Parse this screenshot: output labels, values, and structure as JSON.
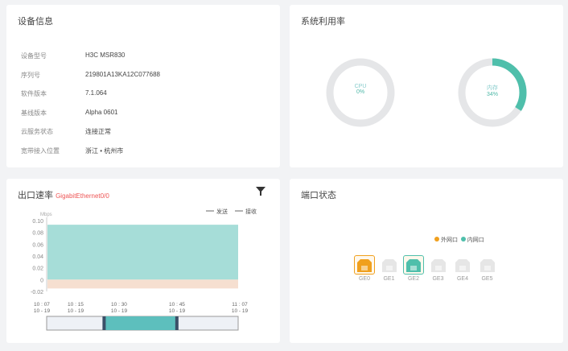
{
  "device_info": {
    "title": "设备信息",
    "rows": [
      {
        "label": "设备型号",
        "value": "H3C MSR830"
      },
      {
        "label": "序列号",
        "value": "219801A13KA12C077688"
      },
      {
        "label": "软件版本",
        "value": "7.1.064"
      },
      {
        "label": "基线版本",
        "value": "Alpha 0601"
      },
      {
        "label": "云服务状态",
        "value": "连接正常"
      },
      {
        "label": "宽带接入位置",
        "value": "浙江 • 杭州市"
      }
    ]
  },
  "system_usage": {
    "title": "系统利用率",
    "cpu": {
      "label": "CPU",
      "value": "0%",
      "percent": 0
    },
    "memory": {
      "label": "内存",
      "value": "34%",
      "percent": 34
    },
    "accent": "#4fbfab"
  },
  "egress": {
    "title": "出口速率",
    "interface": "GigabitEthernet0/0",
    "filter_icon": "filter-icon",
    "chart_data": {
      "type": "area",
      "ylabel": "Mbps",
      "yticks": [
        "0.10",
        "0.08",
        "0.06",
        "0.04",
        "0.02",
        "0",
        "-0.02"
      ],
      "ylim": [
        -0.02,
        0.1
      ],
      "xticks": [
        {
          "t": "10 : 07",
          "d": "10 - 19"
        },
        {
          "t": "10 : 15",
          "d": "10 - 19"
        },
        {
          "t": "10 : 30",
          "d": "10 - 19"
        },
        {
          "t": "10 : 45",
          "d": "10 - 19"
        },
        {
          "t": "11 : 07",
          "d": "10 - 19"
        }
      ],
      "series": [
        {
          "name": "发送",
          "value": 0.093,
          "color": "#a6ddd8"
        },
        {
          "name": "接收",
          "value": -0.015,
          "color": "#f6dfd0"
        }
      ],
      "slider": {
        "start": 0.3,
        "end": 0.68
      }
    }
  },
  "ports": {
    "title": "端口状态",
    "legend": [
      {
        "label": "外网口",
        "color": "#f0a01e"
      },
      {
        "label": "内网口",
        "color": "#4fbfab"
      }
    ],
    "items": [
      {
        "label": "GE0",
        "state": "wan"
      },
      {
        "label": "GE1",
        "state": "off"
      },
      {
        "label": "GE2",
        "state": "lan"
      },
      {
        "label": "GE3",
        "state": "off"
      },
      {
        "label": "GE4",
        "state": "off"
      },
      {
        "label": "GE5",
        "state": "off"
      }
    ]
  }
}
